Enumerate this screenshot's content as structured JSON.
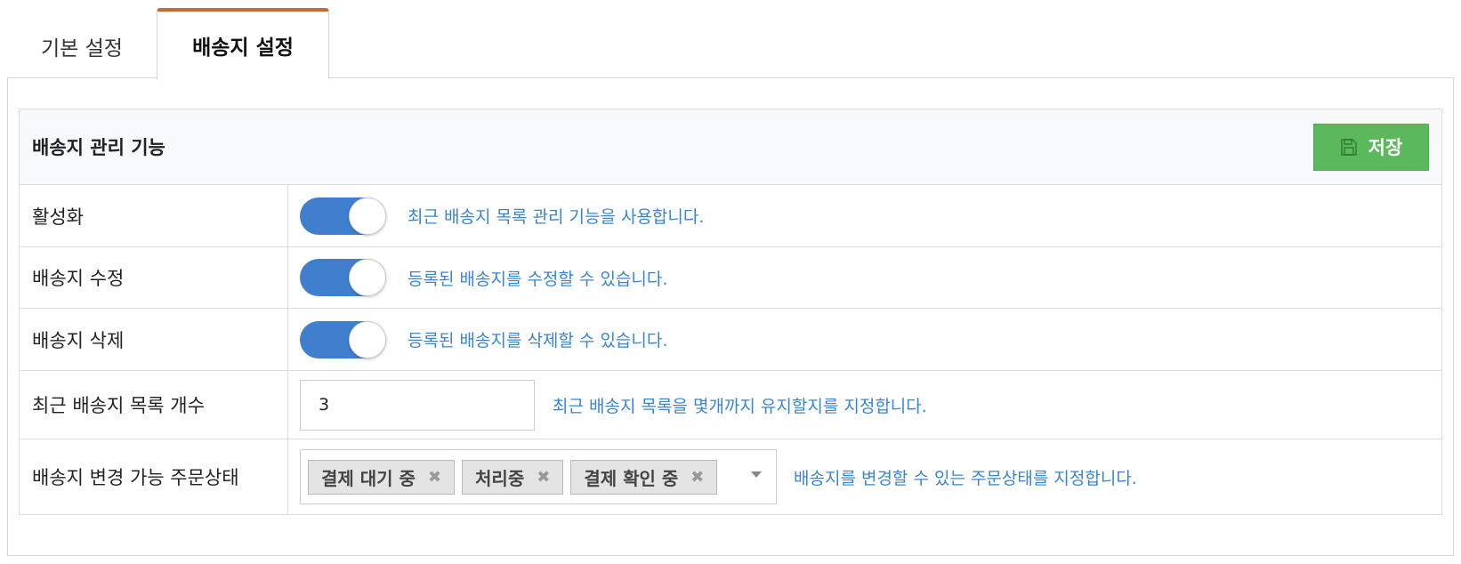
{
  "tabs": {
    "basic": "기본 설정",
    "shipping": "배송지 설정"
  },
  "section": {
    "title": "배송지 관리 기능",
    "save_label": "저장",
    "colors": {
      "save": "#5cb85c",
      "toggle": "#3f7fce",
      "help": "#3a85cf",
      "active_tab_accent": "#c86a2e"
    }
  },
  "rows": {
    "activate": {
      "label": "활성화",
      "enabled": true,
      "help": "최근 배송지 목록 관리 기능을 사용합니다."
    },
    "edit": {
      "label": "배송지 수정",
      "enabled": true,
      "help": "등록된 배송지를 수정할 수 있습니다."
    },
    "delete": {
      "label": "배송지 삭제",
      "enabled": true,
      "help": "등록된 배송지를 삭제할 수 있습니다."
    },
    "count": {
      "label": "최근 배송지 목록 개수",
      "value": "3",
      "help": "최근 배송지 목록을 몇개까지 유지할지를 지정합니다."
    },
    "statuses": {
      "label": "배송지 변경 가능 주문상태",
      "selected": [
        "결제 대기 중",
        "처리중",
        "결제 확인 중"
      ],
      "remove_glyph": "✖",
      "help": "배송지를 변경할 수 있는 주문상태를 지정합니다."
    }
  },
  "icons": {
    "save": "floppy-disk-icon",
    "remove": "close-icon",
    "dropdown": "caret-down-icon"
  }
}
